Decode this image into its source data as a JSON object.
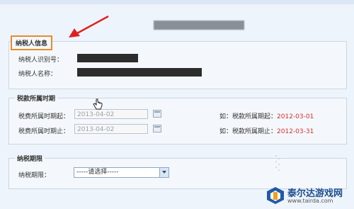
{
  "taxpayer_section": {
    "legend": "纳税人信息",
    "id_label": "纳税人识别号：",
    "name_label": "纳税人名称："
  },
  "period_section": {
    "legend": "税款所属时期",
    "start_label": "税费所属时期起：",
    "start_value": "2013-04-02",
    "end_label": "税费所属时期止：",
    "end_value": "2013-04-02",
    "start_hint_prefix": "如：税款所属期起：",
    "start_hint_date": "2012-03-01",
    "end_hint_prefix": "如：税款所属期止：",
    "end_hint_date": "2012-03-31"
  },
  "deadline_section": {
    "legend": "纳税期限",
    "label": "纳税期限：",
    "selected": "-----请选择-----"
  },
  "watermark": {
    "text": "泰尔达游戏网",
    "url": "www.tairda.com"
  },
  "colors": {
    "highlight_box": "#e88b2b",
    "arrow": "#e02020",
    "hint_date": "#d43030"
  },
  "icons": [
    "red-arrow-icon",
    "calendar-icon",
    "dropdown-arrow-icon",
    "hand-cursor-icon",
    "watermark-logo-icon"
  ]
}
